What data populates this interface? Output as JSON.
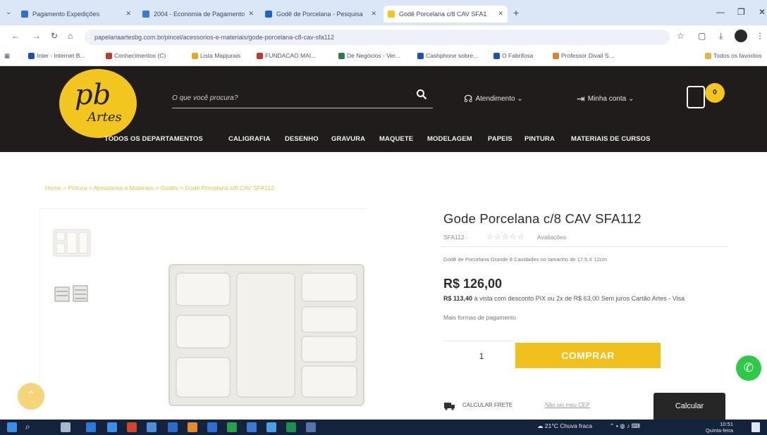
{
  "browser": {
    "tabs": [
      {
        "label": "Pagamento Expedições",
        "color": "#2f6fd0",
        "active": false
      },
      {
        "label": "2004 - Economia de Pagamento",
        "color": "#3a77d6",
        "active": false
      },
      {
        "label": "Godê de Porcelana - Pesquisa",
        "color": "#1a66c7",
        "active": false
      },
      {
        "label": "Godê Porcelana c/8 CAV SFA1",
        "color": "#f2c61f",
        "active": true
      }
    ],
    "new_tab": "+",
    "url": "papelariaartesbg.com.br/pincel/acessorios-e-materiais/gode-porcelana-c8-cav-sfa112",
    "bookmarks": [
      {
        "label": "Inter - Internet B...",
        "color": "#1d4fb8"
      },
      {
        "label": "Conhecimentos (C)",
        "color": "#c0392b"
      },
      {
        "label": "Lista Mapjurais",
        "color": "#e5a91c"
      },
      {
        "label": "FUNDACAO MAI...",
        "color": "#c0392b"
      },
      {
        "label": "De Negócios - Ver...",
        "color": "#2b7a4b"
      },
      {
        "label": "Cashphone sobre...",
        "color": "#1d4fb8"
      },
      {
        "label": "O Fabrifosa",
        "color": "#1d4fb8"
      },
      {
        "label": "Professor Divail S...",
        "color": "#d9822b"
      }
    ],
    "other_bookmarks": "Todos os favoritos"
  },
  "site": {
    "logo_pb": "pb",
    "logo_artes": "Artes",
    "search_placeholder": "O que você procura?",
    "atendimento": "Atendimento",
    "minha_conta": "Minha conta",
    "cart_count": "0",
    "nav": [
      "TODOS OS DEPARTAMENTOS",
      "CALIGRAFIA",
      "DESENHO",
      "GRAVURA",
      "MAQUETE",
      "MODELAGEM",
      "PAPEIS",
      "PINTURA",
      "MATERIAIS DE CURSOS"
    ]
  },
  "product": {
    "breadcrumb": "Home > Pintura > Acessórios e Materiais > Godês > Godê Porcelana c/8 CAV SFA112",
    "title": "Gode Porcelana c/8 CAV SFA112",
    "sku": "SFA112",
    "stars": "☆☆☆☆☆",
    "reviews": "Avaliações",
    "description": "Godê de Porcelana Grande 8 Cavidades no tamanho de 17,5 X 12cm",
    "price": "R$ 126,00",
    "installments_bold": "R$ 113,40",
    "installments_text": "à vista com desconto PIX ou 2x de R$ 63,00 Sem juros Cartão Artes - Visa",
    "installments_more": "Mais formas de pagamento",
    "quantity": "1",
    "buy_label": "COMPRAR",
    "shipping_label": "CALCULAR FRETE",
    "shipping_link": "Não sei meu CEP",
    "calc_label": "Calcular"
  },
  "taskbar": {
    "weather": "21°C Chuva fraca",
    "time": "10:51",
    "date": "Quinta-feira"
  }
}
